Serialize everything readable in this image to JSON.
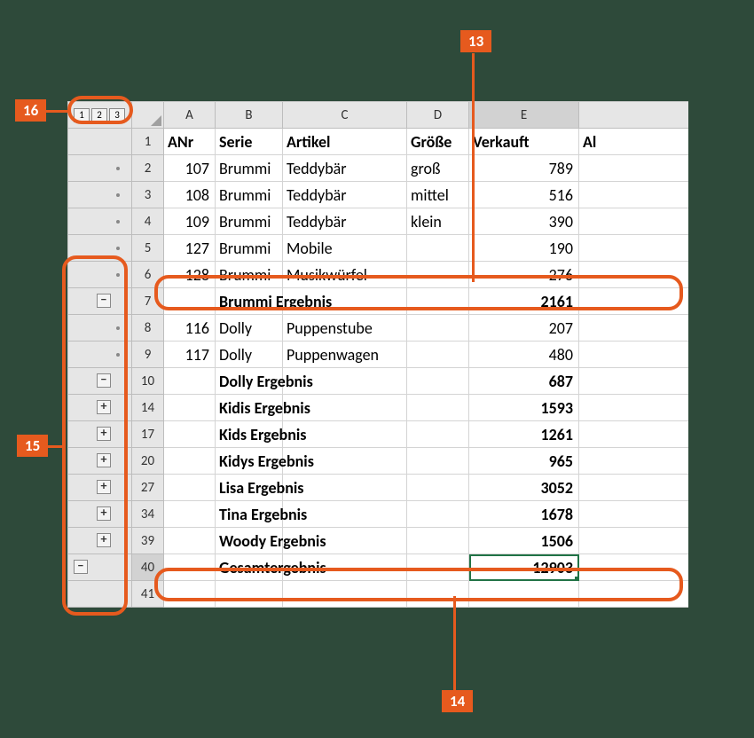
{
  "columns": [
    "A",
    "B",
    "C",
    "D",
    "E"
  ],
  "partialCol": "Al",
  "headers": {
    "A": "ANr",
    "B": "Serie",
    "C": "Artikel",
    "D": "Größe",
    "E": "Verkauft"
  },
  "rows": [
    {
      "n": 1,
      "type": "hdr"
    },
    {
      "n": 2,
      "A": 107,
      "B": "Brummi",
      "C": "Teddybär",
      "D": "groß",
      "E": 789,
      "dot": true
    },
    {
      "n": 3,
      "A": 108,
      "B": "Brummi",
      "C": "Teddybär",
      "D": "mittel",
      "E": 516,
      "dot": true
    },
    {
      "n": 4,
      "A": 109,
      "B": "Brummi",
      "C": "Teddybär",
      "D": "klein",
      "E": 390,
      "dot": true
    },
    {
      "n": 5,
      "A": 127,
      "B": "Brummi",
      "C": "Mobile",
      "D": "",
      "E": 190,
      "dot": true
    },
    {
      "n": 6,
      "A": 128,
      "B": "Brummi",
      "C": "Musikwürfel",
      "D": "",
      "E": 276,
      "dot": true
    },
    {
      "n": 7,
      "B": "Brummi Ergebnis",
      "E": 2161,
      "bold": true,
      "sym": "−"
    },
    {
      "n": 8,
      "A": 116,
      "B": "Dolly",
      "C": "Puppenstube",
      "D": "",
      "E": 207,
      "dot": true
    },
    {
      "n": 9,
      "A": 117,
      "B": "Dolly",
      "C": "Puppenwagen",
      "D": "",
      "E": 480,
      "dot": true
    },
    {
      "n": 10,
      "B": "Dolly Ergebnis",
      "E": 687,
      "bold": true,
      "sym": "−"
    },
    {
      "n": 14,
      "B": "Kidis Ergebnis",
      "E": 1593,
      "bold": true,
      "sym": "+"
    },
    {
      "n": 17,
      "B": "Kids Ergebnis",
      "E": 1261,
      "bold": true,
      "sym": "+"
    },
    {
      "n": 20,
      "B": "Kidys Ergebnis",
      "E": 965,
      "bold": true,
      "sym": "+"
    },
    {
      "n": 27,
      "B": "Lisa Ergebnis",
      "E": 3052,
      "bold": true,
      "sym": "+"
    },
    {
      "n": 34,
      "B": "Tina Ergebnis",
      "E": 1678,
      "bold": true,
      "sym": "+"
    },
    {
      "n": 39,
      "B": "Woody Ergebnis",
      "E": 1506,
      "bold": true,
      "sym": "+"
    },
    {
      "n": 40,
      "B": "Gesamtergebnis",
      "E": 12903,
      "bold": true,
      "grand": true,
      "sym": "−",
      "symLevel": 1
    },
    {
      "n": 41
    }
  ],
  "levels": [
    "1",
    "2",
    "3"
  ],
  "callouts": {
    "c13": "13",
    "c14": "14",
    "c15": "15",
    "c16": "16"
  }
}
